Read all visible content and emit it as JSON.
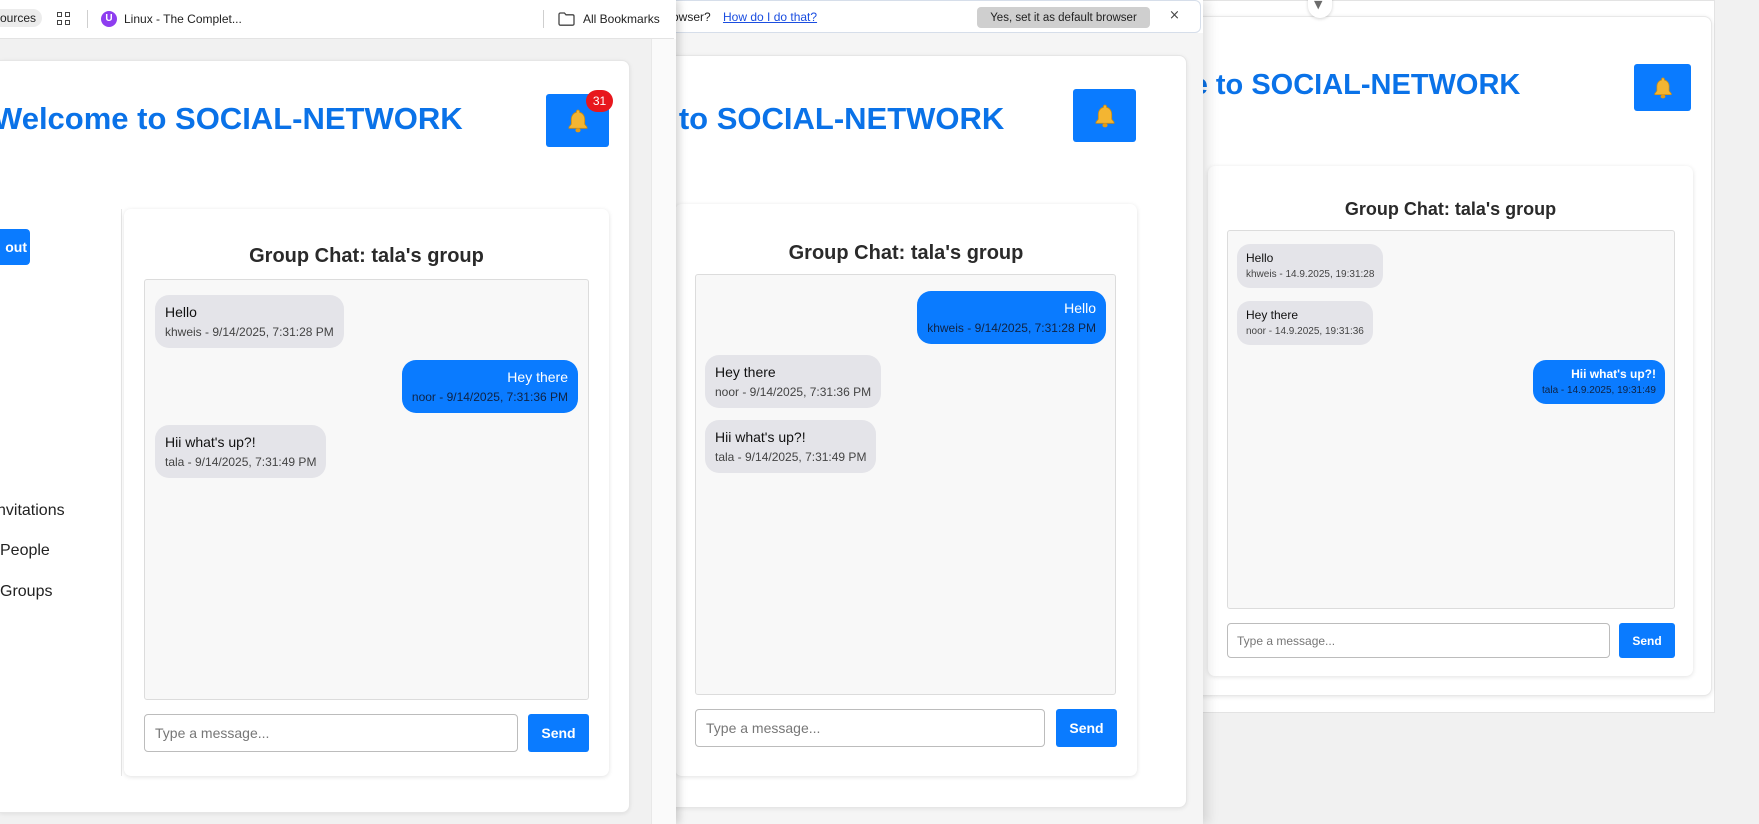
{
  "colors": {
    "accent": "#0a7bff",
    "title_blue": "#0a72e8",
    "badge_red": "#e8171d",
    "incoming_bubble": "#e4e4e9",
    "outgoing_bubble": "#0a7bff"
  },
  "window_left": {
    "bookmarks_bar": {
      "partial_chip": "ources",
      "apps_icon": "grid-icon",
      "bookmark_label": "Linux - The Complet...",
      "bookmark_icon": "linux-course-icon",
      "all_bookmarks_label": "All Bookmarks",
      "all_bookmarks_icon": "folder-icon"
    },
    "header": {
      "title": "Welcome to SOCIAL-NETWORK",
      "notification_icon": "bell-icon",
      "notification_count": "31"
    },
    "sidebar": {
      "logout_label": "out",
      "items": [
        {
          "label": "nvitations"
        },
        {
          "label": "People"
        },
        {
          "label": "Groups"
        }
      ]
    },
    "chat": {
      "title": "Group Chat: tala's group",
      "messages": [
        {
          "text": "Hello",
          "meta": "khweis - 9/14/2025, 7:31:28 PM",
          "own": false
        },
        {
          "text": "Hey there",
          "meta": "noor - 9/14/2025, 7:31:36 PM",
          "own": true
        },
        {
          "text": "Hii what's up?!",
          "meta": "tala - 9/14/2025, 7:31:49 PM",
          "own": false
        }
      ],
      "input_placeholder": "Type a message...",
      "send_label": "Send"
    }
  },
  "window_middle": {
    "infobar": {
      "question_fragment": "owser?",
      "how_link": "How do I do that?",
      "default_button": "Yes, set it as default browser",
      "close_glyph": "×"
    },
    "header": {
      "title": "e to SOCIAL-NETWORK",
      "notification_icon": "bell-icon"
    },
    "chat": {
      "title": "Group Chat: tala's group",
      "messages": [
        {
          "text": "Hello",
          "meta": "khweis - 9/14/2025, 7:31:28 PM",
          "own": true
        },
        {
          "text": "Hey there",
          "meta": "noor - 9/14/2025, 7:31:36 PM",
          "own": false
        },
        {
          "text": "Hii what's up?!",
          "meta": "tala - 9/14/2025, 7:31:49 PM",
          "own": false
        }
      ],
      "input_placeholder": "Type a message...",
      "send_label": "Send"
    }
  },
  "window_right": {
    "dropdown_glyph": "▼",
    "header": {
      "title": "ne to SOCIAL-NETWORK",
      "notification_icon": "bell-icon"
    },
    "chat": {
      "title": "Group Chat: tala's group",
      "messages": [
        {
          "text": "Hello",
          "meta": "khweis - 14.9.2025, 19:31:28",
          "own": false
        },
        {
          "text": "Hey there",
          "meta": "noor - 14.9.2025, 19:31:36",
          "own": false
        },
        {
          "text": "Hii what's up?!",
          "meta": "tala - 14.9.2025, 19:31:49",
          "own": true
        }
      ],
      "input_placeholder": "Type a message...",
      "send_label": "Send"
    }
  }
}
